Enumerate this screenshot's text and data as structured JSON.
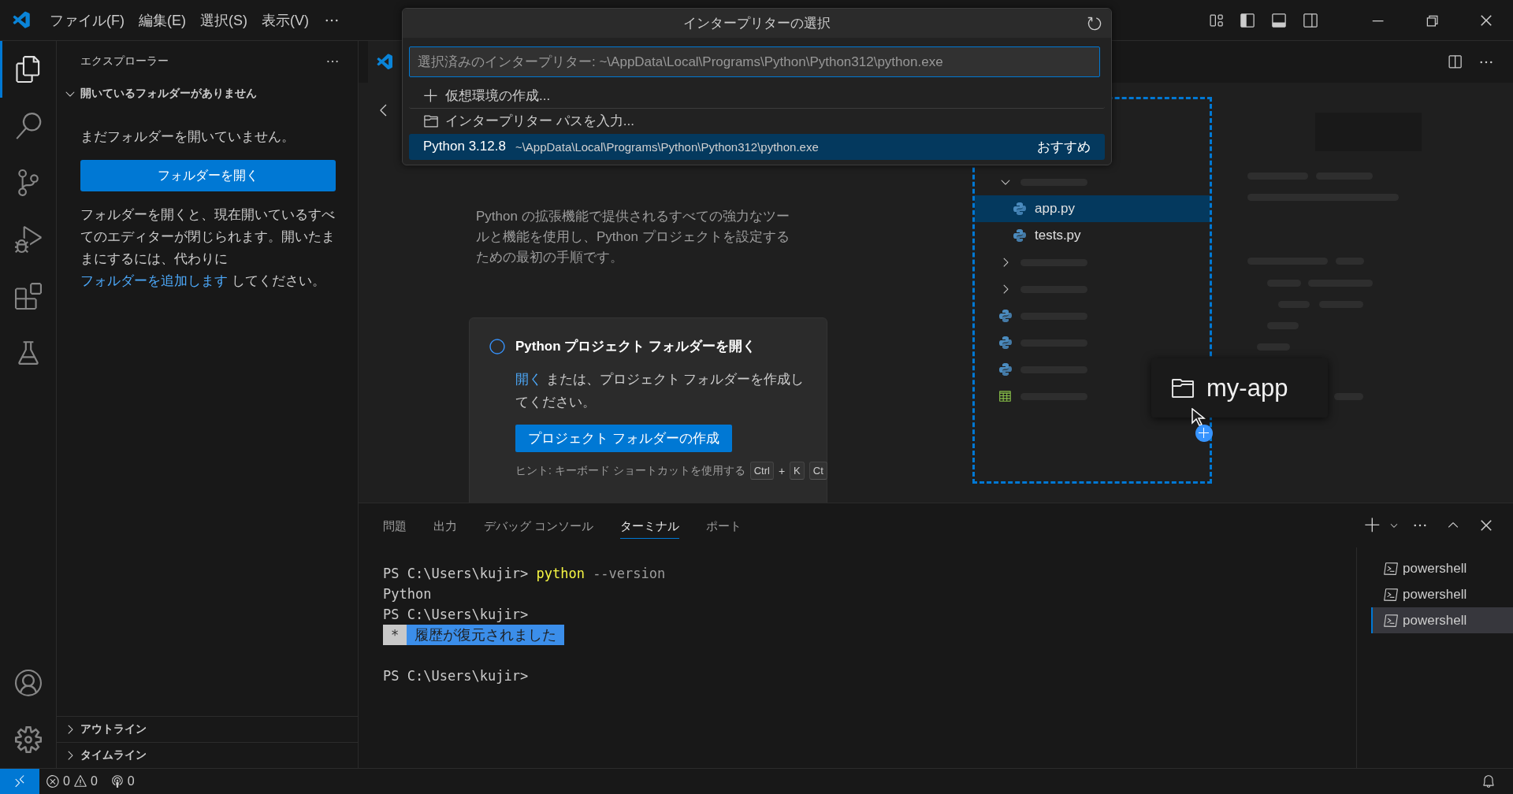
{
  "title_bar": {
    "menus": [
      "ファイル(F)",
      "編集(E)",
      "選択(S)",
      "表示(V)"
    ]
  },
  "activity_bar": {
    "items": [
      {
        "kind": "explorer",
        "selected": true
      },
      {
        "kind": "search",
        "selected": false
      },
      {
        "kind": "scm",
        "selected": false
      },
      {
        "kind": "debug",
        "selected": false
      },
      {
        "kind": "extensions",
        "selected": false
      },
      {
        "kind": "testing",
        "selected": false
      }
    ],
    "bottom": [
      {
        "kind": "account"
      },
      {
        "kind": "settings"
      }
    ]
  },
  "sidebar": {
    "title": "エクスプローラー",
    "section": {
      "title": "開いているフォルダーがありません",
      "expanded": true
    },
    "message": "まだフォルダーを開いていません。",
    "open_button": "フォルダーを開く",
    "note": {
      "before": "フォルダーを開くと、現在開いているすべてのエディターが閉じられます。開いたままにするには、代わりに ",
      "link": "フォルダーを追加します",
      "after": " してください。"
    },
    "bottom_sections": [
      {
        "title": "アウトライン",
        "expanded": false
      },
      {
        "title": "タイムライン",
        "expanded": false
      }
    ]
  },
  "quick_pick": {
    "title": "インタープリターの選択",
    "placeholder": "選択済みのインタープリター: ~\\AppData\\Local\\Programs\\Python\\Python312\\python.exe",
    "items": [
      {
        "kind": "create",
        "label": "仮想環境の作成...",
        "selected": false
      },
      {
        "kind": "browse",
        "label": "インタープリター パスを入力...",
        "selected": false
      },
      {
        "kind": "interpreter",
        "label": "Python 3.12.8",
        "detail": "~\\AppData\\Local\\Programs\\Python\\Python312\\python.exe",
        "badge": "おすすめ",
        "selected": true
      }
    ]
  },
  "welcome": {
    "description": "Python の拡張機能で提供されるすべての強力なツールと機能を使用し、Python プロジェクトを設定するための最初の手順です。",
    "step": {
      "title": "Python プロジェクト フォルダーを開く",
      "link": "開く",
      "text": " または、プロジェクト フォルダーを作成してください。",
      "button": "プロジェクト フォルダーの作成",
      "hint": "ヒント: キーボード ショートカットを使用する",
      "keys": [
        {
          "kind": "key",
          "text": "Ctrl"
        },
        {
          "kind": "plus",
          "text": "+"
        },
        {
          "kind": "key",
          "text": "K"
        },
        {
          "kind": "key",
          "text": "Ct"
        }
      ]
    }
  },
  "illustration": {
    "rows": [
      {
        "kind": "folder",
        "expanded": true,
        "children": [
          {
            "kind": "python",
            "name": "app.py",
            "selected": true
          },
          {
            "kind": "python",
            "name": "tests.py",
            "selected": false
          }
        ]
      },
      {
        "kind": "folder",
        "expanded": false
      },
      {
        "kind": "folder",
        "expanded": false
      },
      {
        "kind": "python"
      },
      {
        "kind": "python"
      },
      {
        "kind": "python"
      },
      {
        "kind": "table"
      }
    ],
    "drag_label": "my-app"
  },
  "panel": {
    "tabs": [
      {
        "label": "問題",
        "selected": false
      },
      {
        "label": "出力",
        "selected": false
      },
      {
        "label": "デバッグ コンソール",
        "selected": false
      },
      {
        "label": "ターミナル",
        "selected": true
      },
      {
        "label": "ポート",
        "selected": false
      }
    ],
    "lines": [
      {
        "kind": "text",
        "segments": [
          {
            "kind": "prompt",
            "text": "PS C:\\Users\\kujir> "
          },
          {
            "kind": "command",
            "text": "python"
          },
          {
            "kind": "arg",
            "text": " --version"
          }
        ]
      },
      {
        "kind": "text",
        "segments": [
          {
            "kind": "output",
            "text": "Python"
          }
        ]
      },
      {
        "kind": "text",
        "segments": [
          {
            "kind": "prompt",
            "text": "PS C:\\Users\\kujir>"
          }
        ]
      },
      {
        "kind": "text",
        "segments": [
          {
            "kind": "mark",
            "text": "*"
          },
          {
            "kind": "notice",
            "text": "履歴が復元されました"
          }
        ]
      },
      {
        "kind": "blank"
      },
      {
        "kind": "text",
        "segments": [
          {
            "kind": "prompt",
            "text": "PS C:\\Users\\kujir>"
          }
        ]
      }
    ],
    "terminals": [
      {
        "name": "powershell",
        "selected": false
      },
      {
        "name": "powershell",
        "selected": false
      },
      {
        "name": "powershell",
        "selected": true
      }
    ]
  },
  "status_bar": {
    "errors": "0",
    "warnings": "0",
    "ports": "0"
  }
}
